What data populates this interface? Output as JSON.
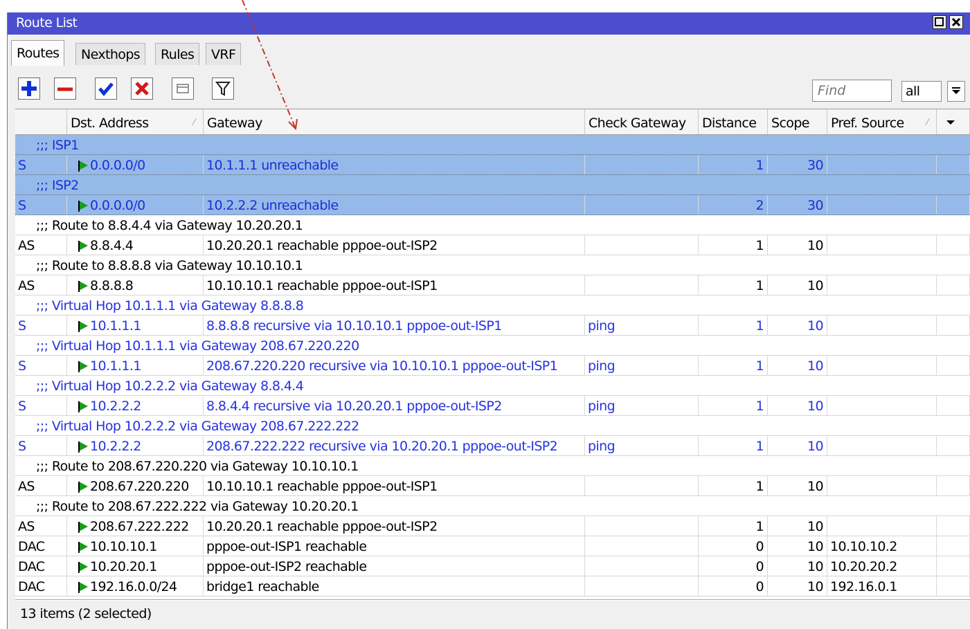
{
  "window": {
    "title": "Route List"
  },
  "tabs": [
    "Routes",
    "Nexthops",
    "Rules",
    "VRF"
  ],
  "toolbar": {
    "find_placeholder": "Find",
    "filter_value": "all"
  },
  "columns": [
    "",
    "Dst. Address",
    "Gateway",
    "Check Gateway",
    "Distance",
    "Scope",
    "Pref. Source"
  ],
  "rows": [
    {
      "type": "comment",
      "text": ";;; ISP1",
      "selected": true
    },
    {
      "type": "route",
      "flags": "S",
      "dst": "0.0.0.0/0",
      "gateway": "10.1.1.1 unreachable",
      "check": "",
      "distance": "1",
      "scope": "30",
      "pref": "",
      "selected": true
    },
    {
      "type": "comment",
      "text": ";;; ISP2",
      "selected": true
    },
    {
      "type": "route",
      "flags": "S",
      "dst": "0.0.0.0/0",
      "gateway": "10.2.2.2 unreachable",
      "check": "",
      "distance": "2",
      "scope": "30",
      "pref": "",
      "selected": true
    },
    {
      "type": "comment",
      "text": ";;; Route to 8.8.4.4 via Gateway 10.20.20.1"
    },
    {
      "type": "route",
      "flags": "AS",
      "dst": "8.8.4.4",
      "gateway": "10.20.20.1 reachable pppoe-out-ISP2",
      "check": "",
      "distance": "1",
      "scope": "10",
      "pref": ""
    },
    {
      "type": "comment",
      "text": ";;; Route to 8.8.8.8 via Gateway 10.10.10.1"
    },
    {
      "type": "route",
      "flags": "AS",
      "dst": "8.8.8.8",
      "gateway": "10.10.10.1 reachable pppoe-out-ISP1",
      "check": "",
      "distance": "1",
      "scope": "10",
      "pref": ""
    },
    {
      "type": "comment",
      "text": ";;; Virtual Hop 10.1.1.1 via Gateway 8.8.8.8",
      "blue": true
    },
    {
      "type": "route",
      "flags": "S",
      "dst": "10.1.1.1",
      "gateway": "8.8.8.8 recursive via 10.10.10.1 pppoe-out-ISP1",
      "check": "ping",
      "distance": "1",
      "scope": "10",
      "pref": "",
      "blue": true
    },
    {
      "type": "comment",
      "text": ";;; Virtual Hop 10.1.1.1 via Gateway 208.67.220.220",
      "blue": true
    },
    {
      "type": "route",
      "flags": "S",
      "dst": "10.1.1.1",
      "gateway": "208.67.220.220 recursive via 10.10.10.1 pppoe-out-ISP1",
      "check": "ping",
      "distance": "1",
      "scope": "10",
      "pref": "",
      "blue": true
    },
    {
      "type": "comment",
      "text": ";;; Virtual Hop 10.2.2.2 via Gateway 8.8.4.4",
      "blue": true
    },
    {
      "type": "route",
      "flags": "S",
      "dst": "10.2.2.2",
      "gateway": "8.8.4.4 recursive via 10.20.20.1 pppoe-out-ISP2",
      "check": "ping",
      "distance": "1",
      "scope": "10",
      "pref": "",
      "blue": true
    },
    {
      "type": "comment",
      "text": ";;; Virtual Hop 10.2.2.2 via Gateway 208.67.222.222",
      "blue": true
    },
    {
      "type": "route",
      "flags": "S",
      "dst": "10.2.2.2",
      "gateway": "208.67.222.222 recursive via 10.20.20.1 pppoe-out-ISP2",
      "check": "ping",
      "distance": "1",
      "scope": "10",
      "pref": "",
      "blue": true
    },
    {
      "type": "comment",
      "text": ";;; Route to 208.67.220.220 via Gateway 10.10.10.1"
    },
    {
      "type": "route",
      "flags": "AS",
      "dst": "208.67.220.220",
      "gateway": "10.10.10.1 reachable pppoe-out-ISP1",
      "check": "",
      "distance": "1",
      "scope": "10",
      "pref": ""
    },
    {
      "type": "comment",
      "text": ";;; Route to 208.67.222.222 via Gateway 10.20.20.1"
    },
    {
      "type": "route",
      "flags": "AS",
      "dst": "208.67.222.222",
      "gateway": "10.20.20.1 reachable pppoe-out-ISP2",
      "check": "",
      "distance": "1",
      "scope": "10",
      "pref": ""
    },
    {
      "type": "route",
      "flags": "DAC",
      "dst": "10.10.10.1",
      "gateway": "pppoe-out-ISP1 reachable",
      "check": "",
      "distance": "0",
      "scope": "10",
      "pref": "10.10.10.2"
    },
    {
      "type": "route",
      "flags": "DAC",
      "dst": "10.20.20.1",
      "gateway": "pppoe-out-ISP2 reachable",
      "check": "",
      "distance": "0",
      "scope": "10",
      "pref": "10.20.20.2"
    },
    {
      "type": "route",
      "flags": "DAC",
      "dst": "192.16.0.0/24",
      "gateway": "bridge1 reachable",
      "check": "",
      "distance": "0",
      "scope": "10",
      "pref": "192.16.0.1"
    }
  ],
  "status": "13 items (2 selected)",
  "colors": {
    "title_bar": "#4b4fcf",
    "selected_row": "#95bae9",
    "blue_text": "#2632e0",
    "flag": "#1b9a1b",
    "annotation_arrow": "#c0392b"
  }
}
